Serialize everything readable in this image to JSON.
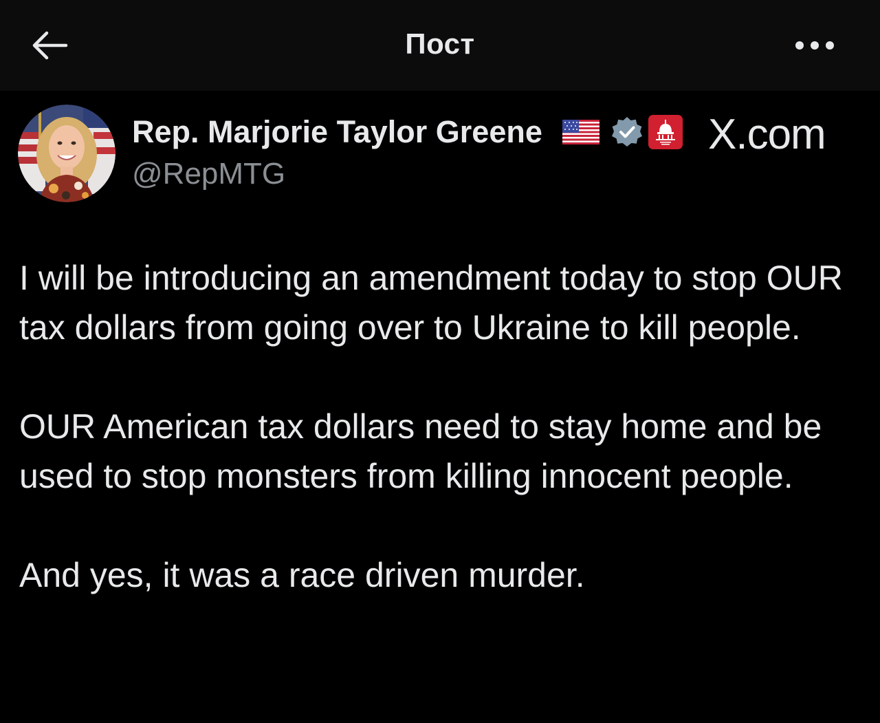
{
  "header": {
    "title": "Пост",
    "back_icon": "arrow-left-icon",
    "more_icon": "more-horizontal-icon"
  },
  "author": {
    "name": "Rep. Marjorie Taylor Greene",
    "handle": "@RepMTG",
    "flag_icon": "us-flag-icon",
    "verified_icon": "verified-badge-icon",
    "affiliation_icon": "house-gop-badge-icon"
  },
  "watermark": "X.com",
  "post": {
    "paragraphs": [
      "I will be introducing an amendment today to stop OUR tax dollars from going over to Ukraine to kill people.",
      "OUR American tax dollars need to stay home and be used to stop monsters from killing innocent people.",
      "And yes, it was a race driven murder."
    ]
  },
  "colors": {
    "background": "#000000",
    "header_background": "#0c0c0d",
    "text_primary": "#e7e9ea",
    "text_secondary": "#8b8f94",
    "verified_badge": "#829aab",
    "gop_badge": "#d1202f"
  }
}
